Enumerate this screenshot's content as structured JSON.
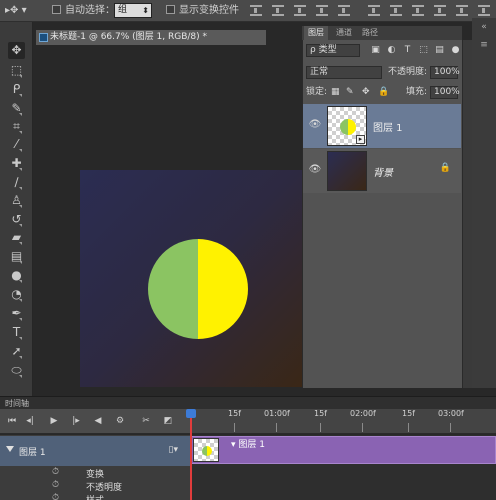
{
  "options_bar": {
    "auto_select_label": "自动选择：",
    "auto_select_value": "组",
    "show_transform_label": "显示变换控件"
  },
  "tools": [
    "move",
    "marquee",
    "lasso",
    "quick-select",
    "crop",
    "eyedropper",
    "healing-brush",
    "brush",
    "clone-stamp",
    "history-brush",
    "eraser",
    "gradient",
    "blur",
    "dodge",
    "pen",
    "type",
    "path-select",
    "shape"
  ],
  "document": {
    "tab_title": "未标题-1 @ 66.7% (图层 1, RGB/8) *",
    "circle_left_color": "#8bc462",
    "circle_right_color": "#fff200"
  },
  "layers_panel": {
    "tabs": [
      "图层",
      "通道",
      "路径"
    ],
    "filter_kind": "类型",
    "blend_mode": "正常",
    "opacity_label": "不透明度:",
    "opacity_value": "100%",
    "lock_label": "锁定:",
    "fill_label": "填充:",
    "fill_value": "100%",
    "layers": [
      {
        "name": "图层 1",
        "selected": true
      },
      {
        "name": "背景",
        "locked": true
      }
    ]
  },
  "timeline": {
    "title": "时间轴",
    "ruler_ticks": [
      "15f",
      "01:00f",
      "15f",
      "02:00f",
      "15f",
      "03:00f"
    ],
    "track_name": "图层 1",
    "clip_name": "图层 1",
    "properties": [
      "变换",
      "不透明度",
      "样式"
    ]
  }
}
